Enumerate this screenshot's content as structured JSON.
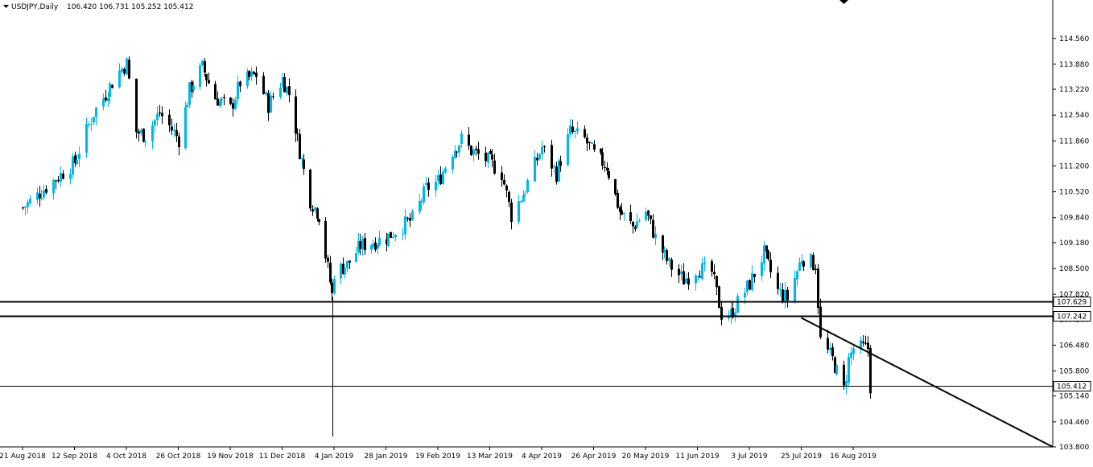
{
  "header": {
    "symbol_timeframe": "USDJPY,Daily",
    "ohlc": "106.420 106.731 105.252 105.412"
  },
  "colors": {
    "bull": "#00b7e6",
    "bear": "#000000",
    "line": "#000000",
    "background": "#ffffff",
    "price_label_bg": "#ffffff"
  },
  "chart_data": {
    "type": "candlestick",
    "ylim": [
      103.8,
      115.0
    ],
    "y_ticks": [
      "114.560",
      "113.880",
      "113.220",
      "112.540",
      "111.860",
      "111.200",
      "110.520",
      "109.840",
      "109.180",
      "108.500",
      "107.820",
      "107.160",
      "106.480",
      "105.800",
      "105.140",
      "104.460",
      "103.800"
    ],
    "x_ticks": [
      "21 Aug 2018",
      "12 Sep 2018",
      "4 Oct 2018",
      "26 Oct 2018",
      "19 Nov 2018",
      "11 Dec 2018",
      "4 Jan 2019",
      "28 Jan 2019",
      "19 Feb 2019",
      "13 Mar 2019",
      "4 Apr 2019",
      "26 Apr 2019",
      "20 May 2019",
      "11 Jun 2019",
      "3 Jul 2019",
      "25 Jul 2019",
      "16 Aug 2019"
    ],
    "horizontal_levels": [
      {
        "value": 107.629,
        "label": "107.629",
        "weight": "thick"
      },
      {
        "value": 107.242,
        "label": "107.242",
        "weight": "thick"
      },
      {
        "value": 105.412,
        "label": "105.412",
        "weight": "thin"
      }
    ],
    "trendline": {
      "from": {
        "date": "25 Jul 2019",
        "price": 107.2
      },
      "to": {
        "price": 103.8
      }
    },
    "vertical_marker": {
      "date": "4 Jan 2019"
    },
    "close_path": [
      [
        "21 Aug 2018",
        110.1
      ],
      [
        "12 Sep 2018",
        111.3
      ],
      [
        "20 Sep 2018",
        112.6
      ],
      [
        "1 Oct 2018",
        113.7
      ],
      [
        "4 Oct 2018",
        113.9
      ],
      [
        "8 Oct 2018",
        112.1
      ],
      [
        "12 Oct 2018",
        112.0
      ],
      [
        "18 Oct 2018",
        112.6
      ],
      [
        "26 Oct 2018",
        111.9
      ],
      [
        "31 Oct 2018",
        113.2
      ],
      [
        "6 Nov 2018",
        113.8
      ],
      [
        "12 Nov 2018",
        113.0
      ],
      [
        "19 Nov 2018",
        112.7
      ],
      [
        "23 Nov 2018",
        113.4
      ],
      [
        "30 Nov 2018",
        113.6
      ],
      [
        "5 Dec 2018",
        112.8
      ],
      [
        "11 Dec 2018",
        113.5
      ],
      [
        "14 Dec 2018",
        113.1
      ],
      [
        "19 Dec 2018",
        111.6
      ],
      [
        "24 Dec 2018",
        110.3
      ],
      [
        "28 Dec 2018",
        109.9
      ],
      [
        "3 Jan 2019",
        107.8
      ],
      [
        "4 Jan 2019",
        108.4
      ],
      [
        "10 Jan 2019",
        108.6
      ],
      [
        "16 Jan 2019",
        109.1
      ],
      [
        "28 Jan 2019",
        109.3
      ],
      [
        "1 Feb 2019",
        109.5
      ],
      [
        "8 Feb 2019",
        109.8
      ],
      [
        "14 Feb 2019",
        110.6
      ],
      [
        "19 Feb 2019",
        110.8
      ],
      [
        "25 Feb 2019",
        111.6
      ],
      [
        "1 Mar 2019",
        111.9
      ],
      [
        "5 Mar 2019",
        111.6
      ],
      [
        "13 Mar 2019",
        111.3
      ],
      [
        "18 Mar 2019",
        111.0
      ],
      [
        "22 Mar 2019",
        109.9
      ],
      [
        "28 Mar 2019",
        110.6
      ],
      [
        "4 Apr 2019",
        111.7
      ],
      [
        "10 Apr 2019",
        111.0
      ],
      [
        "16 Apr 2019",
        112.1
      ],
      [
        "22 Apr 2019",
        111.9
      ],
      [
        "26 Apr 2019",
        111.5
      ],
      [
        "2 May 2019",
        111.2
      ],
      [
        "8 May 2019",
        110.0
      ],
      [
        "14 May 2019",
        109.6
      ],
      [
        "20 May 2019",
        110.0
      ],
      [
        "24 May 2019",
        109.3
      ],
      [
        "30 May 2019",
        108.6
      ],
      [
        "5 Jun 2019",
        108.2
      ],
      [
        "11 Jun 2019",
        108.5
      ],
      [
        "17 Jun 2019",
        108.4
      ],
      [
        "21 Jun 2019",
        107.3
      ],
      [
        "25 Jun 2019",
        107.3
      ],
      [
        "3 Jul 2019",
        108.1
      ],
      [
        "9 Jul 2019",
        108.9
      ],
      [
        "15 Jul 2019",
        107.9
      ],
      [
        "19 Jul 2019",
        107.7
      ],
      [
        "25 Jul 2019",
        108.8
      ],
      [
        "31 Jul 2019",
        108.6
      ],
      [
        "2 Aug 2019",
        106.6
      ],
      [
        "7 Aug 2019",
        106.1
      ],
      [
        "12 Aug 2019",
        105.3
      ],
      [
        "14 Aug 2019",
        106.1
      ],
      [
        "16 Aug 2019",
        106.4
      ],
      [
        "22 Aug 2019",
        106.4
      ],
      [
        "23 Aug 2019",
        105.4
      ]
    ]
  }
}
